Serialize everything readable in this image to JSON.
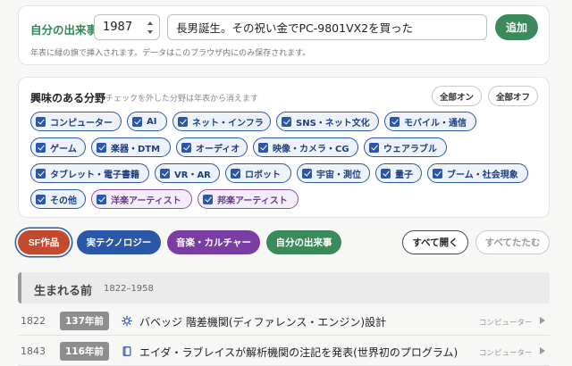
{
  "event_form": {
    "label": "自分の出来事",
    "year_value": "1987",
    "text_value": "長男誕生。その祝い金でPC-9801VX2を買った",
    "add_label": "追加",
    "note": "年表に緑の旗で挿入されます。データはこのブラウザ内にのみ保存されます。"
  },
  "interests": {
    "title": "興味のある分野",
    "subtitle": "チェックを外した分野は年表から消えます",
    "all_on_label": "全部オン",
    "all_off_label": "全部オフ",
    "items": [
      {
        "label": "コンピューター",
        "checked": true,
        "group": "blue"
      },
      {
        "label": "AI",
        "checked": true,
        "group": "blue"
      },
      {
        "label": "ネット・インフラ",
        "checked": true,
        "group": "blue"
      },
      {
        "label": "SNS・ネット文化",
        "checked": true,
        "group": "blue"
      },
      {
        "label": "モバイル・通信",
        "checked": true,
        "group": "blue"
      },
      {
        "label": "ゲーム",
        "checked": true,
        "group": "blue"
      },
      {
        "label": "楽器・DTM",
        "checked": true,
        "group": "blue"
      },
      {
        "label": "オーディオ",
        "checked": true,
        "group": "blue"
      },
      {
        "label": "映像・カメラ・CG",
        "checked": true,
        "group": "blue"
      },
      {
        "label": "ウェアラブル",
        "checked": true,
        "group": "blue"
      },
      {
        "label": "タブレット・電子書籍",
        "checked": true,
        "group": "blue"
      },
      {
        "label": "VR・AR",
        "checked": true,
        "group": "blue"
      },
      {
        "label": "ロボット",
        "checked": true,
        "group": "blue"
      },
      {
        "label": "宇宙・測位",
        "checked": true,
        "group": "blue"
      },
      {
        "label": "量子",
        "checked": true,
        "group": "blue"
      },
      {
        "label": "ブーム・社会現象",
        "checked": true,
        "group": "blue"
      },
      {
        "label": "その他",
        "checked": true,
        "group": "blue"
      },
      {
        "label": "洋楽アーティスト",
        "checked": true,
        "group": "purple"
      },
      {
        "label": "邦楽アーティスト",
        "checked": true,
        "group": "purple"
      }
    ]
  },
  "categories": {
    "sf": "SF作品",
    "tech": "実テクノロジー",
    "culture": "音楽・カルチャー",
    "personal": "自分の出来事",
    "colors": {
      "sf": "#c24a2e",
      "tech": "#2a57a8",
      "culture": "#7a3da3",
      "personal": "#3b8a5c"
    }
  },
  "controls": {
    "expand_all": "すべて開く",
    "collapse_all": "すべてたたむ"
  },
  "section": {
    "title": "生まれる前",
    "range": "1822–1958"
  },
  "rows": [
    {
      "year": "1822",
      "ago": "137年前",
      "icon": "gear-icon",
      "title": "バベッジ 階差機関(ディファレンス・エンジン)設計",
      "category": "コンピューター"
    },
    {
      "year": "1843",
      "ago": "116年前",
      "icon": "book-icon",
      "title": "エイダ・ラブレイスが解析機関の注記を発表(世界初のプログラム)",
      "category": "コンピューター"
    }
  ]
}
